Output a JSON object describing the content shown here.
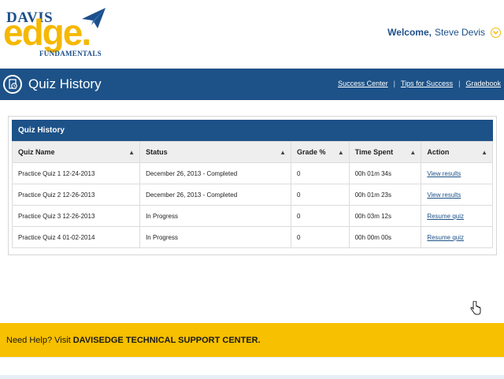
{
  "brand": {
    "logo_top": "DAVIS",
    "logo_main": "edge.",
    "logo_sub": "FUNDAMENTALS",
    "accent_color": "#f5b800",
    "primary_color": "#1d5288"
  },
  "header": {
    "welcome_label": "Welcome,",
    "user_name": "Steve Devis"
  },
  "title_bar": {
    "title": "Quiz History",
    "links": [
      "Success Center",
      "Tips for Success",
      "Gradebook"
    ],
    "separator": "|"
  },
  "panel": {
    "heading": "Quiz History",
    "columns": [
      "Quiz Name",
      "Status",
      "Grade %",
      "Time Spent",
      "Action"
    ],
    "rows": [
      {
        "name": "Practice Quiz 1 12-24-2013",
        "status": "December 26, 2013 - Completed",
        "grade": "0",
        "time": "00h 01m 34s",
        "action": "View results"
      },
      {
        "name": "Practice Quiz 2 12-26-2013",
        "status": "December 26, 2013 - Completed",
        "grade": "0",
        "time": "00h 01m 23s",
        "action": "View results"
      },
      {
        "name": "Practice Quiz 3 12-26-2013",
        "status": "In Progress",
        "grade": "0",
        "time": "00h 03m 12s",
        "action": "Resume quiz"
      },
      {
        "name": "Practice Quiz 4 01-02-2014",
        "status": "In Progress",
        "grade": "0",
        "time": "00h 00m 00s",
        "action": "Resume quiz"
      }
    ]
  },
  "help": {
    "text": "Need Help? Visit",
    "link": "DAVISEDGE TECHNICAL SUPPORT CENTER."
  },
  "icons": {
    "sort": "sort-arrows-icon",
    "user_menu": "chevron-down-icon",
    "title": "quiz-history-icon",
    "cursor": "pointer-cursor-icon"
  }
}
